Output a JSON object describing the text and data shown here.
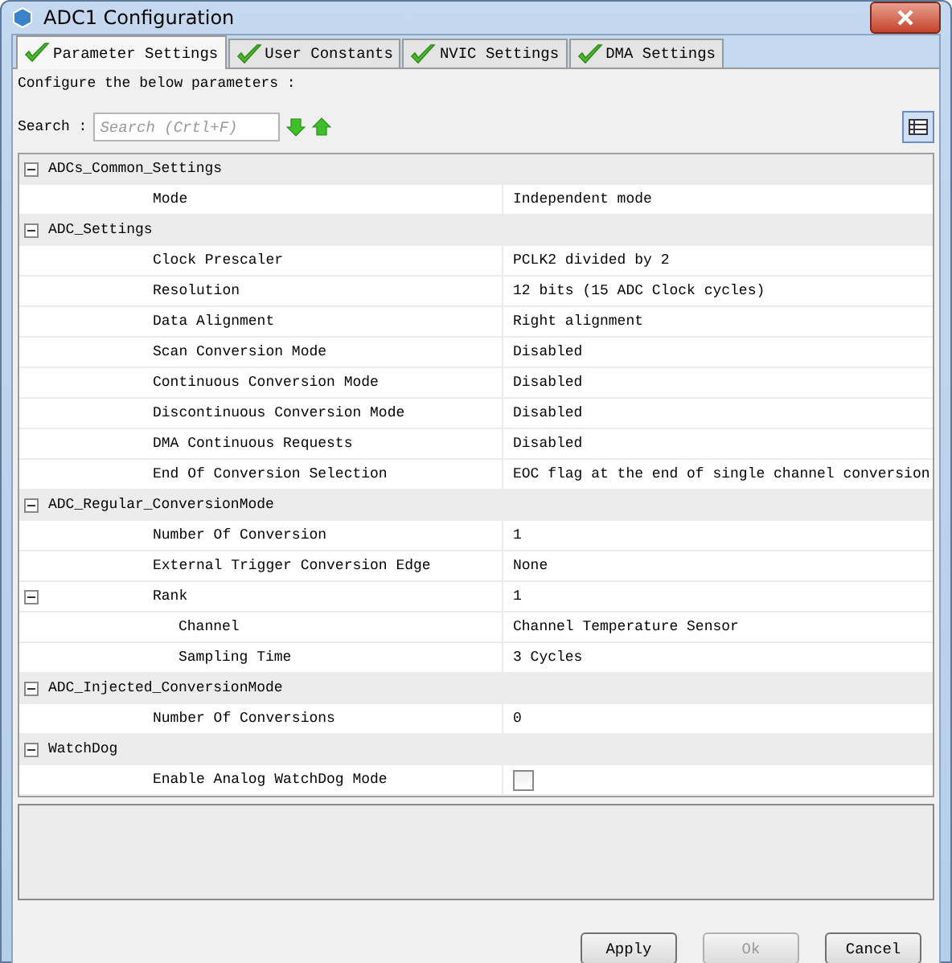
{
  "window": {
    "title": "ADC1 Configuration"
  },
  "tabs": [
    {
      "label": "Parameter Settings",
      "selected": true
    },
    {
      "label": "User Constants",
      "selected": false
    },
    {
      "label": "NVIC Settings",
      "selected": false
    },
    {
      "label": "DMA Settings",
      "selected": false
    }
  ],
  "intro": "Configure the below parameters :",
  "search": {
    "label": "Search :",
    "placeholder": "Search (Crtl+F)"
  },
  "groups": [
    {
      "name": "ADCs_Common_Settings",
      "expanded": true,
      "items": [
        {
          "kind": "text",
          "label": "Mode",
          "value": "Independent mode"
        }
      ]
    },
    {
      "name": "ADC_Settings",
      "expanded": true,
      "items": [
        {
          "kind": "text",
          "label": "Clock Prescaler",
          "value": "PCLK2 divided by 2"
        },
        {
          "kind": "text",
          "label": "Resolution",
          "value": "12 bits (15 ADC Clock cycles)"
        },
        {
          "kind": "text",
          "label": "Data Alignment",
          "value": "Right alignment"
        },
        {
          "kind": "text",
          "label": "Scan Conversion Mode",
          "value": "Disabled"
        },
        {
          "kind": "text",
          "label": "Continuous Conversion Mode",
          "value": "Disabled"
        },
        {
          "kind": "text",
          "label": "Discontinuous Conversion Mode",
          "value": "Disabled"
        },
        {
          "kind": "text",
          "label": "DMA Continuous Requests",
          "value": "Disabled"
        },
        {
          "kind": "text",
          "label": "End Of Conversion Selection",
          "value": "EOC flag at the end of single channel conversion"
        }
      ]
    },
    {
      "name": "ADC_Regular_ConversionMode",
      "expanded": true,
      "items": [
        {
          "kind": "text",
          "label": "Number Of Conversion",
          "value": "1"
        },
        {
          "kind": "text",
          "label": "External Trigger Conversion Edge",
          "value": "None"
        },
        {
          "kind": "node",
          "label": "Rank",
          "value": "1",
          "expanded": true,
          "children": [
            {
              "kind": "text",
              "label": "Channel",
              "value": "Channel Temperature Sensor"
            },
            {
              "kind": "text",
              "label": "Sampling Time",
              "value": "3 Cycles"
            }
          ]
        }
      ]
    },
    {
      "name": "ADC_Injected_ConversionMode",
      "expanded": true,
      "items": [
        {
          "kind": "text",
          "label": "Number Of Conversions",
          "value": "0"
        }
      ]
    },
    {
      "name": "WatchDog",
      "expanded": true,
      "items": [
        {
          "kind": "checkbox",
          "label": "Enable Analog WatchDog Mode",
          "checked": false
        }
      ]
    }
  ],
  "buttons": [
    {
      "label": "Apply",
      "disabled": false
    },
    {
      "label": "Ok",
      "disabled": true
    },
    {
      "label": "Cancel",
      "disabled": false
    }
  ]
}
